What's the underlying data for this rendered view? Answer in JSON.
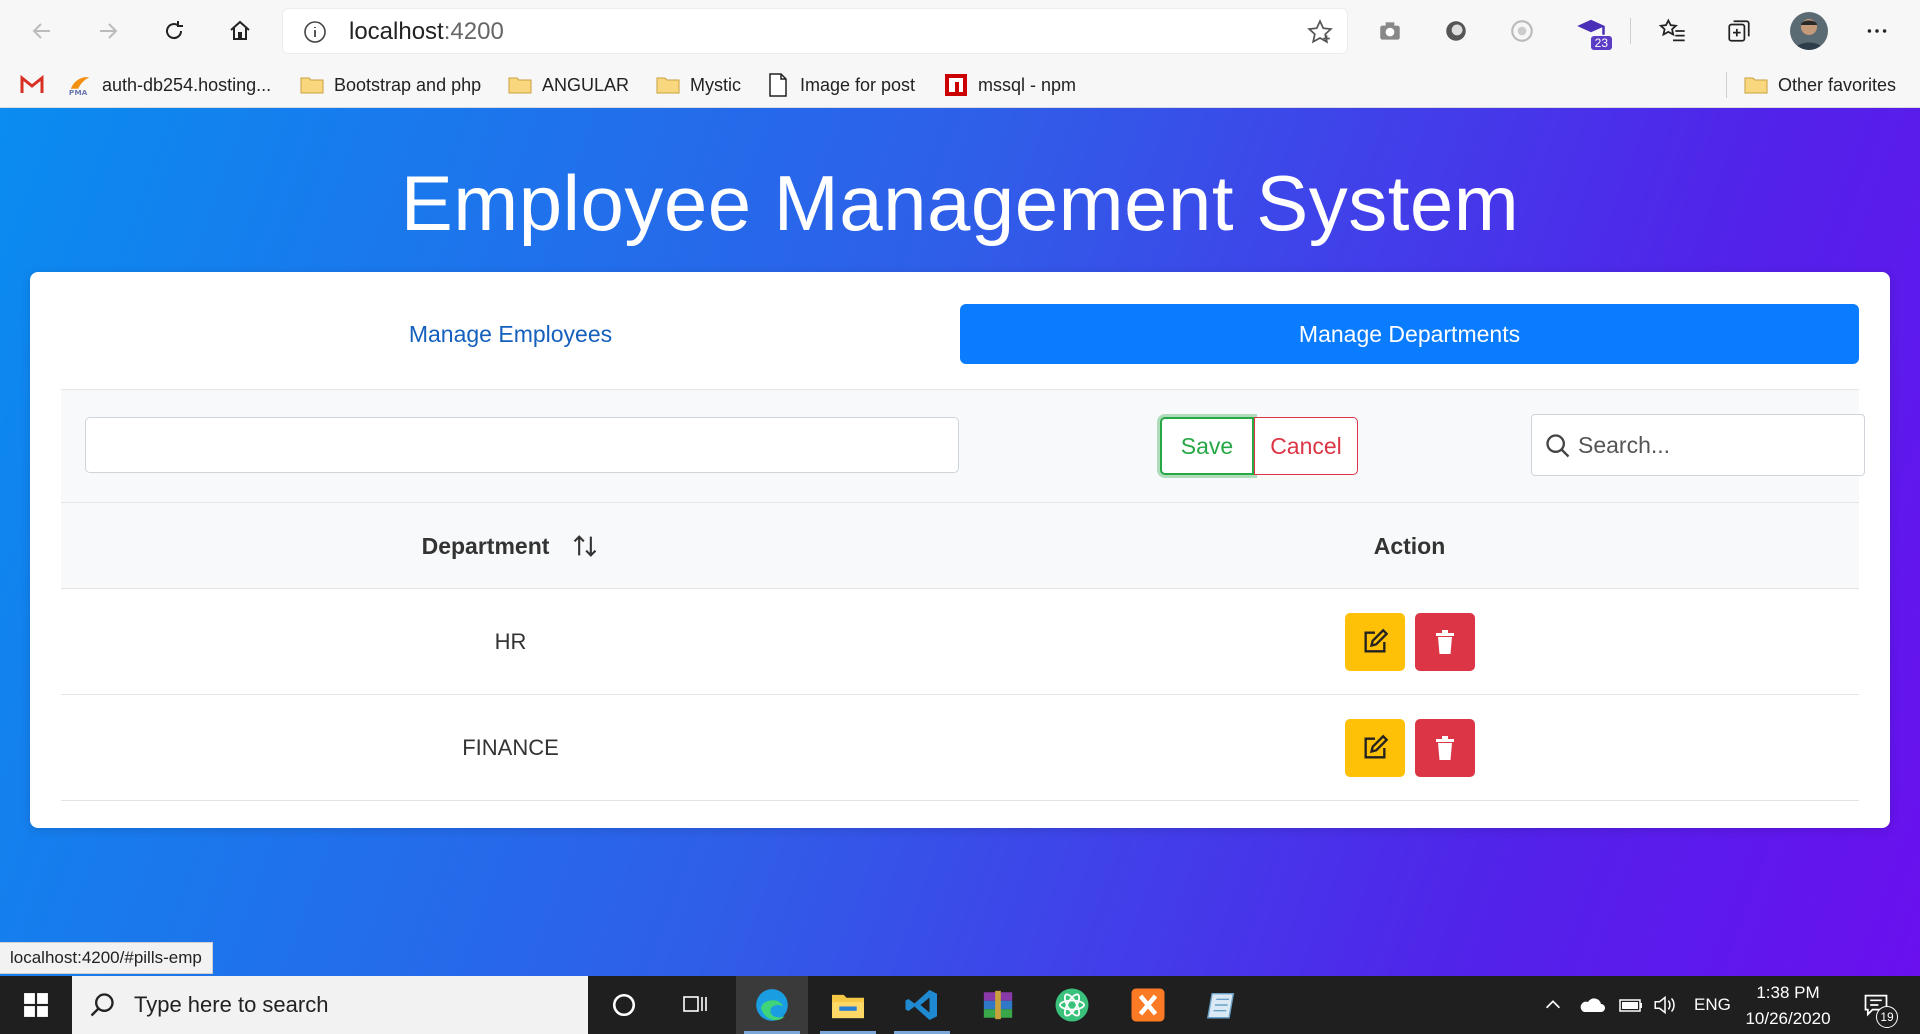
{
  "browser": {
    "url_host": "localhost",
    "url_port": ":4200",
    "bookmarks": [
      {
        "label": "",
        "icon": "gmail-icon"
      },
      {
        "label": "auth-db254.hosting...",
        "icon": "phpmyadmin-icon"
      },
      {
        "label": "Bootstrap and php",
        "icon": "folder-icon"
      },
      {
        "label": "ANGULAR",
        "icon": "folder-icon"
      },
      {
        "label": "Mystic",
        "icon": "folder-icon"
      },
      {
        "label": "Image for post",
        "icon": "page-icon"
      },
      {
        "label": "mssql - npm",
        "icon": "npm-icon"
      }
    ],
    "other_favorites": "Other favorites",
    "extension_badge": "23",
    "status_url": "localhost:4200/#pills-emp"
  },
  "page": {
    "title": "Employee Management System",
    "tabs": [
      {
        "label": "Manage Employees",
        "active": false
      },
      {
        "label": "Manage Departments",
        "active": true
      }
    ],
    "form": {
      "department_value": "",
      "save_label": "Save",
      "cancel_label": "Cancel",
      "search_placeholder": "Search..."
    },
    "table": {
      "headers": [
        "Department",
        "Action"
      ],
      "rows": [
        {
          "department": "HR"
        },
        {
          "department": "FINANCE"
        }
      ]
    },
    "colors": {
      "primary": "#0a7cff",
      "success": "#28a745",
      "danger": "#dc3545",
      "warning": "#ffc107"
    }
  },
  "taskbar": {
    "search_placeholder": "Type here to search",
    "language": "ENG",
    "time": "1:38 PM",
    "date": "10/26/2020",
    "notification_count": "19"
  }
}
